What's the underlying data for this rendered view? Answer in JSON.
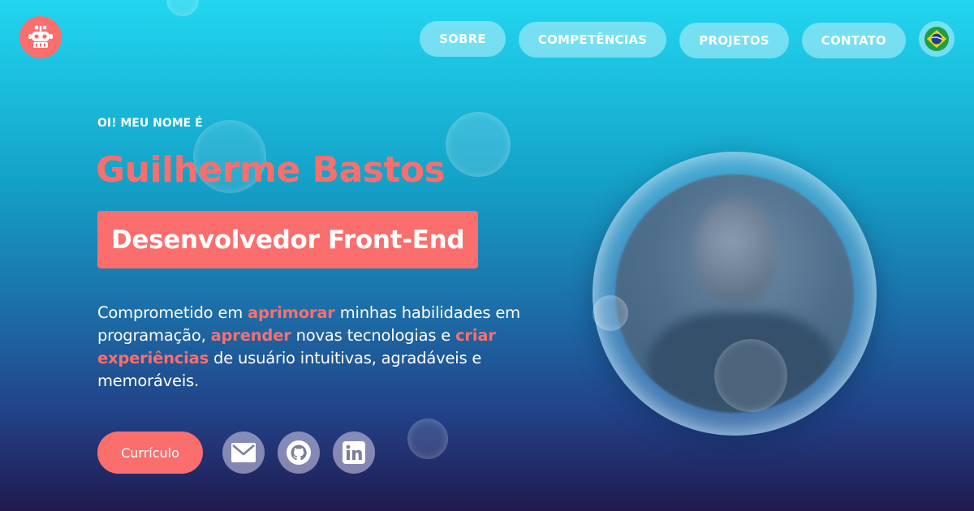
{
  "nav": {
    "items": [
      {
        "label": "SOBRE"
      },
      {
        "label": "COMPETÊNCIAS"
      },
      {
        "label": "PROJETOS"
      },
      {
        "label": "CONTATO"
      }
    ],
    "language_icon": "brazil-flag-icon"
  },
  "logo": {
    "icon": "robot-logo-icon"
  },
  "hero": {
    "greeting": "OI! MEU NOME É",
    "name": "Guilherme Bastos",
    "role": "Desenvolvedor Front-End",
    "bio": {
      "t1": "Comprometido em ",
      "h1": "aprimorar",
      "t2": " minhas habilidades em programação, ",
      "h2": "aprender",
      "t3": " novas tecnologias e ",
      "h3": "criar experiências",
      "t4": " de usuário intuitivas, agradáveis e memoráveis."
    },
    "cv_button": "Currículo",
    "social": [
      {
        "icon": "mail-icon"
      },
      {
        "icon": "github-icon"
      },
      {
        "icon": "linkedin-icon"
      }
    ]
  },
  "colors": {
    "accent": "#fa6f6e",
    "background_top": "#22d6f0",
    "background_bottom": "#211a4f"
  }
}
